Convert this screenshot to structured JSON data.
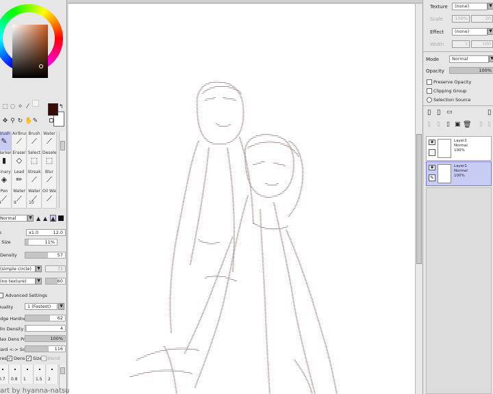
{
  "brushes": [
    {
      "label": "Brush",
      "icon": "pencil-icon"
    },
    {
      "label": "AirBrush",
      "icon": "airbrush-icon"
    },
    {
      "label": "Brush",
      "icon": "brush-icon"
    },
    {
      "label": "Water",
      "icon": "water-icon"
    },
    {
      "label": "Marker",
      "icon": "marker-icon"
    },
    {
      "label": "Eraser",
      "icon": "eraser-icon"
    },
    {
      "label": "Select",
      "icon": "select-icon"
    },
    {
      "label": "Deselect",
      "icon": "deselect-icon"
    },
    {
      "label": "Binary",
      "icon": "binary-icon"
    },
    {
      "label": "Lead",
      "icon": "lead-icon"
    },
    {
      "label": "Streak",
      "icon": "streak-icon"
    },
    {
      "label": "Blur",
      "icon": "blur-icon"
    },
    {
      "label": "Pen",
      "icon": "pen-icon",
      "number": "9"
    },
    {
      "label": "Water",
      "icon": "water-icon",
      "number": "9"
    },
    {
      "label": "Water",
      "icon": "water-icon",
      "number": "10"
    },
    {
      "label": "Oil Water",
      "icon": "oil-water-icon"
    }
  ],
  "tool_settings": {
    "blend_mode": "Normal",
    "size_min": "x1.0",
    "size_value": "12.0",
    "min_size_label": "Size",
    "min_size_value": "11%",
    "density_label": "Density",
    "density_value": "57",
    "shape": "(simple circle)",
    "shape_value": "72",
    "texture": "(no texture)",
    "texture_value": "60",
    "advanced_label": "Advanced Settings",
    "quality_label": "Quality",
    "quality_value": "1 (Fastest)",
    "edge_hardness_label": "Edge Hardness",
    "edge_hardness_value": "62",
    "min_density_label": "Min Density",
    "min_density_value": "4",
    "max_dens_prs_label": "Max Dens Prs.",
    "max_dens_prs_value": "100%",
    "hard_soft_label": "Hard <-> Soft",
    "hard_soft_value": "116",
    "press_label": "Press:",
    "dens_label": "Dens",
    "size_label": "Size",
    "blend_label": "Blend",
    "size_presets": [
      "0.7",
      "0.8",
      "1",
      "1.5",
      "2"
    ]
  },
  "right_panel": {
    "texture_label": "Texture",
    "texture_value": "(none)",
    "scale_label": "Scale",
    "scale_value": "100%",
    "scale_num": "20",
    "effect_label": "Effect",
    "effect_value": "(none)",
    "width_label": "Width",
    "width_value": "1",
    "width_num": "100",
    "mode_label": "Mode",
    "mode_value": "Normal",
    "opacity_label": "Opacity",
    "opacity_value": "100%",
    "opacity_level": 1.0,
    "preserve_opacity": "Preserve Opacity",
    "clipping_group": "Clipping Group",
    "selection_source": "Selection Source"
  },
  "layers": [
    {
      "name": "Layer2",
      "mode": "Normal",
      "opacity": "100%",
      "selected": false
    },
    {
      "name": "Layer1",
      "mode": "Normal",
      "opacity": "100%",
      "selected": true
    }
  ],
  "watermark": "art by hyanna-natsu",
  "colors": {
    "foreground": "#3a0a06",
    "background": "#ffffff",
    "selection": "#c8ccf4",
    "sketch": "#5a3a38"
  }
}
